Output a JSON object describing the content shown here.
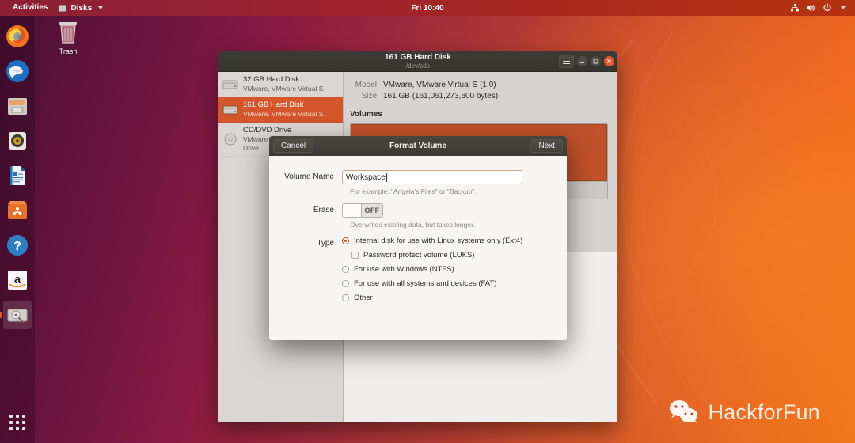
{
  "topbar": {
    "activities": "Activities",
    "app_menu": "Disks",
    "clock": "Fri 10:40",
    "icons": [
      "network-icon",
      "volume-icon",
      "power-icon",
      "chevron-down-icon"
    ]
  },
  "dock": {
    "items": [
      {
        "name": "firefox",
        "label": "Firefox",
        "running": false
      },
      {
        "name": "thunderbird",
        "label": "Thunderbird Mail",
        "running": false
      },
      {
        "name": "files",
        "label": "Files",
        "running": false
      },
      {
        "name": "rhythmbox",
        "label": "Rhythmbox",
        "running": false
      },
      {
        "name": "libreoffice-writer",
        "label": "LibreOffice Writer",
        "running": false
      },
      {
        "name": "ubuntu-software",
        "label": "Ubuntu Software",
        "running": false
      },
      {
        "name": "help",
        "label": "Help",
        "running": false
      },
      {
        "name": "amazon",
        "label": "Amazon",
        "running": false
      },
      {
        "name": "disks",
        "label": "Disks",
        "running": true
      }
    ],
    "show_apps_label": "Show Applications"
  },
  "desktop": {
    "trash_label": "Trash",
    "watermark": "HackforFun"
  },
  "window": {
    "title": "161 GB Hard Disk",
    "subtitle": "/dev/sdb",
    "menu_icon": "hamburger-icon",
    "controls": [
      "minimize-icon",
      "maximize-icon",
      "close-icon"
    ],
    "sidebar": {
      "disks": [
        {
          "name": "32 GB Hard Disk",
          "model": "VMware, VMware Virtual S",
          "selected": false
        },
        {
          "name": "161 GB Hard Disk",
          "model": "VMware, VMware Virtual S",
          "selected": true
        },
        {
          "name": "CD/DVD Drive",
          "model": "VMware Virtual SATA CDRW Drive",
          "selected": false
        }
      ]
    },
    "details": {
      "model_label": "Model",
      "model_value": "VMware, VMware Virtual S (1.0)",
      "size_label": "Size",
      "size_value": "161 GB (161,061,273,600 bytes)",
      "volumes_label": "Volumes"
    }
  },
  "dialog": {
    "cancel": "Cancel",
    "title": "Format Volume",
    "next": "Next",
    "volume_name": {
      "label": "Volume Name",
      "value": "Workspace",
      "placeholder": "",
      "hint": "For example: \"Angela's Files\" or \"Backup\"."
    },
    "erase": {
      "label": "Erase",
      "state": "OFF",
      "hint": "Overwrites existing data, but takes longer."
    },
    "type": {
      "label": "Type",
      "options": [
        {
          "text": "Internal disk for use with Linux systems only (Ext4)",
          "kind": "radio",
          "selected": true,
          "sub": false
        },
        {
          "text": "Password protect volume (LUKS)",
          "kind": "checkbox",
          "selected": false,
          "sub": true
        },
        {
          "text": "For use with Windows (NTFS)",
          "kind": "radio",
          "selected": false,
          "sub": false
        },
        {
          "text": "For use with all systems and devices (FAT)",
          "kind": "radio",
          "selected": false,
          "sub": false
        },
        {
          "text": "Other",
          "kind": "radio",
          "selected": false,
          "sub": false
        }
      ]
    }
  },
  "colors": {
    "accent": "#e95420",
    "selection": "#d4562a",
    "titlebar": "#3c3b37",
    "panel": "#d6d3d0"
  }
}
